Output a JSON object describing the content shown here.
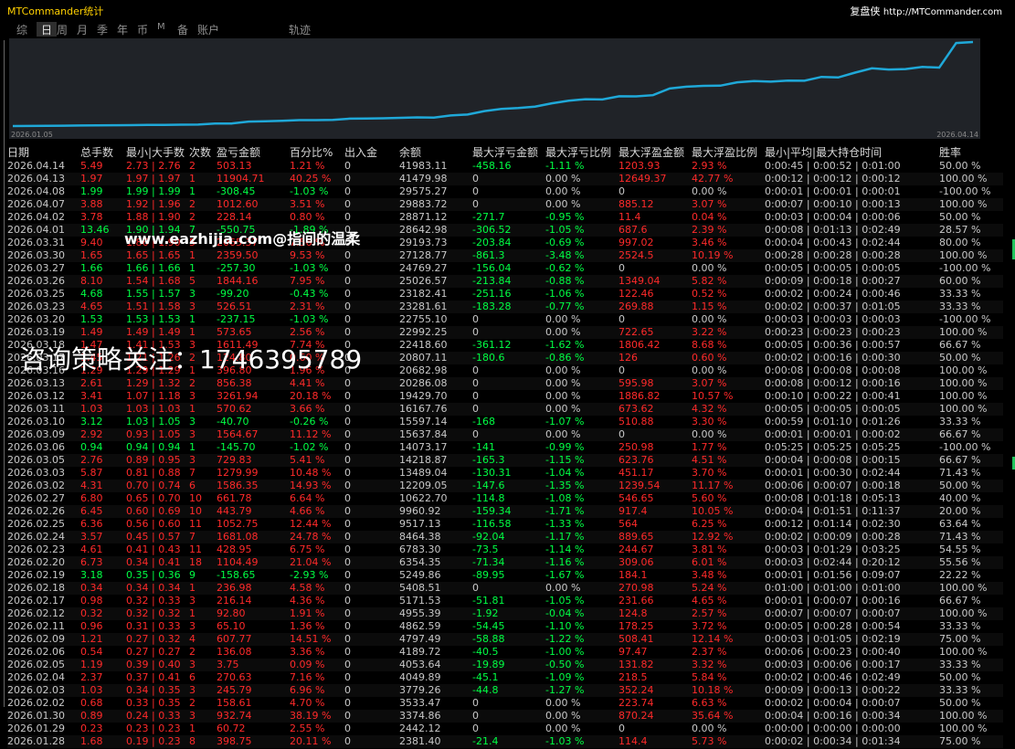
{
  "app": {
    "title": "MTCommander统计",
    "brand_label": "复盘侠",
    "brand_url": "http://MTCommander.com"
  },
  "tabs": [
    "综",
    "日",
    "周",
    "月",
    "季",
    "年",
    "币",
    "M",
    "备",
    "账户",
    "轨迹"
  ],
  "active_tab": "日",
  "equity_chart": {
    "type": "line",
    "x_start_label": "2026.01.05",
    "x_end_label": "2026.04.14",
    "line_color": "#1fa8d8"
  },
  "colors": {
    "positive": "#ff2a2a",
    "negative": "#00ff44",
    "text": "#c8c8c8",
    "title": "#ffd000"
  },
  "table": {
    "headers": [
      "日期",
      "总手数",
      "最小|大手数",
      "次数",
      "盈亏金额",
      "百分比%",
      "出入金",
      "余额",
      "最大浮亏金额",
      "最大浮亏比例",
      "最大浮盈金额",
      "最大浮盈比例",
      "最小|平均|最大持仓时间",
      "胜率"
    ],
    "rows": [
      [
        "2026.04.14",
        "5.49",
        "2.73 | 2.76",
        "2",
        "503.13",
        "1.21 %",
        "0",
        "41983.11",
        "-458.16",
        "-1.11 %",
        "1203.93",
        "2.93 %",
        "0:00:45 | 0:00:52 | 0:01:00",
        "50.00 %"
      ],
      [
        "2026.04.13",
        "1.97",
        "1.97 | 1.97",
        "1",
        "11904.71",
        "40.25 %",
        "0",
        "41479.98",
        "0",
        "0.00 %",
        "12649.37",
        "42.77 %",
        "0:00:12 | 0:00:12 | 0:00:12",
        "100.00 %"
      ],
      [
        "2026.04.08",
        "1.99",
        "1.99 | 1.99",
        "1",
        "-308.45",
        "-1.03 %",
        "0",
        "29575.27",
        "0",
        "0.00 %",
        "0",
        "0.00 %",
        "0:00:01 | 0:00:01 | 0:00:01",
        "-100.00 %"
      ],
      [
        "2026.04.07",
        "3.88",
        "1.92 | 1.96",
        "2",
        "1012.60",
        "3.51 %",
        "0",
        "29883.72",
        "0",
        "0.00 %",
        "885.12",
        "3.07 %",
        "0:00:07 | 0:00:10 | 0:00:13",
        "100.00 %"
      ],
      [
        "2026.04.02",
        "3.78",
        "1.88 | 1.90",
        "2",
        "228.14",
        "0.80 %",
        "0",
        "28871.12",
        "-271.7",
        "-0.95 %",
        "11.4",
        "0.04 %",
        "0:00:03 | 0:00:04 | 0:00:06",
        "50.00 %"
      ],
      [
        "2026.04.01",
        "13.46",
        "1.90 | 1.94",
        "7",
        "-550.75",
        "-1.89 %",
        "0",
        "28642.98",
        "-306.52",
        "-1.05 %",
        "687.6",
        "2.39 %",
        "0:00:08 | 0:01:13 | 0:02:49",
        "28.57 %"
      ],
      [
        "2026.03.31",
        "9.40",
        "1.86 | 1.90",
        "5",
        "2065.37",
        "7.56 %",
        "0",
        "29193.73",
        "-203.84",
        "-0.69 %",
        "997.02",
        "3.46 %",
        "0:00:04 | 0:00:43 | 0:02:44",
        "80.00 %"
      ],
      [
        "2026.03.30",
        "1.65",
        "1.65 | 1.65",
        "1",
        "2359.50",
        "9.53 %",
        "0",
        "27128.77",
        "-861.3",
        "-3.48 %",
        "2524.5",
        "10.19 %",
        "0:00:28 | 0:00:28 | 0:00:28",
        "100.00 %"
      ],
      [
        "2026.03.27",
        "1.66",
        "1.66 | 1.66",
        "1",
        "-257.30",
        "-1.03 %",
        "0",
        "24769.27",
        "-156.04",
        "-0.62 %",
        "0",
        "0.00 %",
        "0:00:05 | 0:00:05 | 0:00:05",
        "-100.00 %"
      ],
      [
        "2026.03.26",
        "8.10",
        "1.54 | 1.68",
        "5",
        "1844.16",
        "7.95 %",
        "0",
        "25026.57",
        "-213.84",
        "-0.88 %",
        "1349.04",
        "5.82 %",
        "0:00:09 | 0:00:18 | 0:00:27",
        "60.00 %"
      ],
      [
        "2026.03.25",
        "4.68",
        "1.55 | 1.57",
        "3",
        "-99.20",
        "-0.43 %",
        "0",
        "23182.41",
        "-251.16",
        "-1.06 %",
        "122.46",
        "0.52 %",
        "0:00:02 | 0:00:24 | 0:00:46",
        "33.33 %"
      ],
      [
        "2026.03.23",
        "4.65",
        "1.51 | 1.58",
        "3",
        "526.51",
        "2.31 %",
        "0",
        "23281.61",
        "-183.28",
        "-0.77 %",
        "269.88",
        "1.15 %",
        "0:00:02 | 0:00:37 | 0:01:05",
        "33.33 %"
      ],
      [
        "2026.03.20",
        "1.53",
        "1.53 | 1.53",
        "1",
        "-237.15",
        "-1.03 %",
        "0",
        "22755.10",
        "0",
        "0.00 %",
        "0",
        "0.00 %",
        "0:00:03 | 0:00:03 | 0:00:03",
        "-100.00 %"
      ],
      [
        "2026.03.19",
        "1.49",
        "1.49 | 1.49",
        "1",
        "573.65",
        "2.56 %",
        "0",
        "22992.25",
        "0",
        "0.00 %",
        "722.65",
        "3.22 %",
        "0:00:23 | 0:00:23 | 0:00:23",
        "100.00 %"
      ],
      [
        "2026.03.18",
        "1.47",
        "1.41 | 1.53",
        "3",
        "1611.49",
        "7.74 %",
        "0",
        "22418.60",
        "-361.12",
        "-1.62 %",
        "1806.42",
        "8.68 %",
        "0:00:05 | 0:00:36 | 0:00:57",
        "66.67 %"
      ],
      [
        "2026.03.17",
        "1.45",
        "1.21 | 1.26",
        "2",
        "124.80",
        "0.60 %",
        "0",
        "20807.11",
        "-180.6",
        "-0.86 %",
        "126",
        "0.60 %",
        "0:00:02 | 0:00:16 | 0:00:30",
        "50.00 %"
      ],
      [
        "2026.03.16",
        "1.29",
        "1.29 | 1.29",
        "1",
        "396.80",
        "1.96 %",
        "0",
        "20682.98",
        "0",
        "0.00 %",
        "0",
        "0.00 %",
        "0:00:08 | 0:00:08 | 0:00:08",
        "100.00 %"
      ],
      [
        "2026.03.13",
        "2.61",
        "1.29 | 1.32",
        "2",
        "856.38",
        "4.41 %",
        "0",
        "20286.08",
        "0",
        "0.00 %",
        "595.98",
        "3.07 %",
        "0:00:08 | 0:00:12 | 0:00:16",
        "100.00 %"
      ],
      [
        "2026.03.12",
        "3.41",
        "1.07 | 1.18",
        "3",
        "3261.94",
        "20.18 %",
        "0",
        "19429.70",
        "0",
        "0.00 %",
        "1886.82",
        "10.57 %",
        "0:00:10 | 0:00:22 | 0:00:41",
        "100.00 %"
      ],
      [
        "2026.03.11",
        "1.03",
        "1.03 | 1.03",
        "1",
        "570.62",
        "3.66 %",
        "0",
        "16167.76",
        "0",
        "0.00 %",
        "673.62",
        "4.32 %",
        "0:00:05 | 0:00:05 | 0:00:05",
        "100.00 %"
      ],
      [
        "2026.03.10",
        "3.12",
        "1.03 | 1.05",
        "3",
        "-40.70",
        "-0.26 %",
        "0",
        "15597.14",
        "-168",
        "-1.07 %",
        "510.88",
        "3.30 %",
        "0:00:59 | 0:01:10 | 0:01:26",
        "33.33 %"
      ],
      [
        "2026.03.09",
        "2.92",
        "0.93 | 1.05",
        "3",
        "1564.67",
        "11.12 %",
        "0",
        "15637.84",
        "0",
        "0.00 %",
        "0",
        "0.00 %",
        "0:00:01 | 0:00:01 | 0:00:02",
        "66.67 %"
      ],
      [
        "2026.03.06",
        "0.94",
        "0.94 | 0.94",
        "1",
        "-145.70",
        "-1.02 %",
        "0",
        "14073.17",
        "-141",
        "-0.99 %",
        "250.98",
        "1.77 %",
        "0:05:25 | 0:05:25 | 0:05:25",
        "-100.00 %"
      ],
      [
        "2026.03.05",
        "2.76",
        "0.89 | 0.95",
        "3",
        "729.83",
        "5.41 %",
        "0",
        "14218.87",
        "-165.3",
        "-1.15 %",
        "623.76",
        "4.51 %",
        "0:00:04 | 0:00:08 | 0:00:15",
        "66.67 %"
      ],
      [
        "2026.03.03",
        "5.87",
        "0.81 | 0.88",
        "7",
        "1279.99",
        "10.48 %",
        "0",
        "13489.04",
        "-130.31",
        "-1.04 %",
        "451.17",
        "3.70 %",
        "0:00:01 | 0:00:30 | 0:02:44",
        "71.43 %"
      ],
      [
        "2026.03.02",
        "4.31",
        "0.70 | 0.74",
        "6",
        "1586.35",
        "14.93 %",
        "0",
        "12209.05",
        "-147.6",
        "-1.35 %",
        "1239.54",
        "11.17 %",
        "0:00:06 | 0:00:07 | 0:00:18",
        "50.00 %"
      ],
      [
        "2026.02.27",
        "6.80",
        "0.65 | 0.70",
        "10",
        "661.78",
        "6.64 %",
        "0",
        "10622.70",
        "-114.8",
        "-1.08 %",
        "546.65",
        "5.60 %",
        "0:00:08 | 0:01:18 | 0:05:13",
        "40.00 %"
      ],
      [
        "2026.02.26",
        "6.45",
        "0.60 | 0.69",
        "10",
        "443.79",
        "4.66 %",
        "0",
        "9960.92",
        "-159.34",
        "-1.71 %",
        "917.4",
        "10.05 %",
        "0:00:04 | 0:01:51 | 0:11:37",
        "20.00 %"
      ],
      [
        "2026.02.25",
        "6.36",
        "0.56 | 0.60",
        "11",
        "1052.75",
        "12.44 %",
        "0",
        "9517.13",
        "-116.58",
        "-1.33 %",
        "564",
        "6.25 %",
        "0:00:12 | 0:01:14 | 0:02:30",
        "63.64 %"
      ],
      [
        "2026.02.24",
        "3.57",
        "0.45 | 0.57",
        "7",
        "1681.08",
        "24.78 %",
        "0",
        "8464.38",
        "-92.04",
        "-1.17 %",
        "889.65",
        "12.92 %",
        "0:00:02 | 0:00:09 | 0:00:28",
        "71.43 %"
      ],
      [
        "2026.02.23",
        "4.61",
        "0.41 | 0.43",
        "11",
        "428.95",
        "6.75 %",
        "0",
        "6783.30",
        "-73.5",
        "-1.14 %",
        "244.67",
        "3.81 %",
        "0:00:03 | 0:01:29 | 0:03:25",
        "54.55 %"
      ],
      [
        "2026.02.20",
        "6.73",
        "0.34 | 0.41",
        "18",
        "1104.49",
        "21.04 %",
        "0",
        "6354.35",
        "-71.34",
        "-1.16 %",
        "309.06",
        "6.01 %",
        "0:00:03 | 0:02:44 | 0:20:12",
        "55.56 %"
      ],
      [
        "2026.02.19",
        "3.18",
        "0.35 | 0.36",
        "9",
        "-158.65",
        "-2.93 %",
        "0",
        "5249.86",
        "-89.95",
        "-1.67 %",
        "184.1",
        "3.48 %",
        "0:00:01 | 0:01:56 | 0:09:07",
        "22.22 %"
      ],
      [
        "2026.02.18",
        "0.34",
        "0.34 | 0.34",
        "1",
        "236.98",
        "4.58 %",
        "0",
        "5408.51",
        "0",
        "0.00 %",
        "270.98",
        "5.24 %",
        "0:01:00 | 0:01:00 | 0:01:00",
        "100.00 %"
      ],
      [
        "2026.02.17",
        "0.98",
        "0.32 | 0.33",
        "3",
        "216.14",
        "4.36 %",
        "0",
        "5171.53",
        "-51.81",
        "-1.05 %",
        "231.66",
        "4.65 %",
        "0:00:01 | 0:00:07 | 0:00:16",
        "66.67 %"
      ],
      [
        "2026.02.12",
        "0.32",
        "0.32 | 0.32",
        "1",
        "92.80",
        "1.91 %",
        "0",
        "4955.39",
        "-1.92",
        "-0.04 %",
        "124.8",
        "2.57 %",
        "0:00:07 | 0:00:07 | 0:00:07",
        "100.00 %"
      ],
      [
        "2026.02.11",
        "0.96",
        "0.31 | 0.33",
        "3",
        "65.10",
        "1.36 %",
        "0",
        "4862.59",
        "-54.45",
        "-1.10 %",
        "178.25",
        "3.72 %",
        "0:00:05 | 0:00:28 | 0:00:54",
        "33.33 %"
      ],
      [
        "2026.02.09",
        "1.21",
        "0.27 | 0.32",
        "4",
        "607.77",
        "14.51 %",
        "0",
        "4797.49",
        "-58.88",
        "-1.22 %",
        "508.41",
        "12.14 %",
        "0:00:03 | 0:01:05 | 0:02:19",
        "75.00 %"
      ],
      [
        "2026.02.06",
        "0.54",
        "0.27 | 0.27",
        "2",
        "136.08",
        "3.36 %",
        "0",
        "4189.72",
        "-40.5",
        "-1.00 %",
        "97.47",
        "2.37 %",
        "0:00:06 | 0:00:23 | 0:00:40",
        "100.00 %"
      ],
      [
        "2026.02.05",
        "1.19",
        "0.39 | 0.40",
        "3",
        "3.75",
        "0.09 %",
        "0",
        "4053.64",
        "-19.89",
        "-0.50 %",
        "131.82",
        "3.32 %",
        "0:00:03 | 0:00:06 | 0:00:17",
        "33.33 %"
      ],
      [
        "2026.02.04",
        "2.37",
        "0.37 | 0.41",
        "6",
        "270.63",
        "7.16 %",
        "0",
        "4049.89",
        "-45.1",
        "-1.09 %",
        "218.5",
        "5.84 %",
        "0:00:02 | 0:00:46 | 0:02:49",
        "50.00 %"
      ],
      [
        "2026.02.03",
        "1.03",
        "0.34 | 0.35",
        "3",
        "245.79",
        "6.96 %",
        "0",
        "3779.26",
        "-44.8",
        "-1.27 %",
        "352.24",
        "10.18 %",
        "0:00:09 | 0:00:13 | 0:00:22",
        "33.33 %"
      ],
      [
        "2026.02.02",
        "0.68",
        "0.33 | 0.35",
        "2",
        "158.61",
        "4.70 %",
        "0",
        "3533.47",
        "0",
        "0.00 %",
        "223.74",
        "6.63 %",
        "0:00:02 | 0:00:04 | 0:00:07",
        "50.00 %"
      ],
      [
        "2026.01.30",
        "0.89",
        "0.24 | 0.33",
        "3",
        "932.74",
        "38.19 %",
        "0",
        "3374.86",
        "0",
        "0.00 %",
        "870.24",
        "35.64 %",
        "0:00:04 | 0:00:16 | 0:00:34",
        "100.00 %"
      ],
      [
        "2026.01.29",
        "0.23",
        "0.23 | 0.23",
        "1",
        "60.72",
        "2.55 %",
        "0",
        "2442.12",
        "0",
        "0.00 %",
        "0",
        "0.00 %",
        "0:00:00 | 0:00:00 | 0:00:00",
        "100.00 %"
      ],
      [
        "2026.01.28",
        "1.68",
        "0.19 | 0.23",
        "8",
        "398.75",
        "20.11 %",
        "0",
        "2381.40",
        "-21.4",
        "-1.03 %",
        "114.4",
        "5.73 %",
        "0:00:02 | 0:00:34 | 0:01:34",
        "75.00 %"
      ]
    ]
  },
  "watermarks": {
    "site": "www.eazhijia.com@指间的温柔",
    "contact": "咨询策略关注：1746395789"
  }
}
